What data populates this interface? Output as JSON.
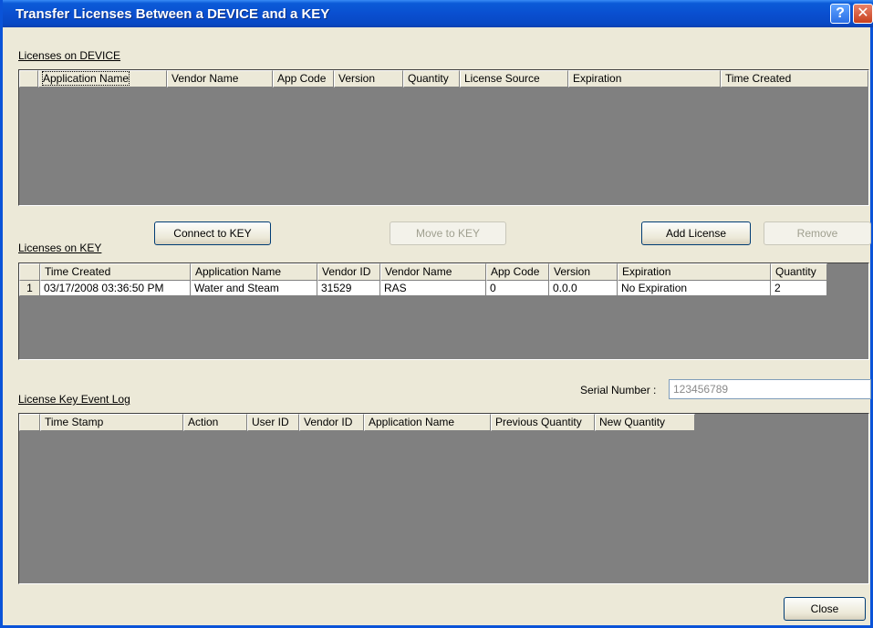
{
  "window": {
    "title": "Transfer Licenses Between a DEVICE and a KEY",
    "help": "?",
    "close": "✕"
  },
  "device": {
    "label": "Licenses on DEVICE",
    "columns": [
      "",
      "Application Name",
      "Vendor Name",
      "App Code",
      "Version",
      "Quantity",
      "License Source",
      "Expiration",
      "Time Created"
    ]
  },
  "buttons": {
    "connect": "Connect to KEY",
    "move": "Move to KEY",
    "add": "Add License",
    "remove": "Remove",
    "close": "Close"
  },
  "key": {
    "label": "Licenses on KEY",
    "columns": [
      "",
      "Time Created",
      "Application Name",
      "Vendor ID",
      "Vendor Name",
      "App Code",
      "Version",
      "Expiration",
      "Quantity"
    ],
    "rows": [
      [
        "1",
        "03/17/2008 03:36:50 PM",
        "Water and Steam",
        "31529",
        "RAS",
        "0",
        "0.0.0",
        "No Expiration",
        "2"
      ]
    ]
  },
  "log": {
    "label": "License Key Event Log",
    "columns": [
      "",
      "Time Stamp",
      "Action",
      "User ID",
      "Vendor ID",
      "Application Name",
      "Previous Quantity",
      "New Quantity"
    ]
  },
  "serial": {
    "label": "Serial Number :",
    "value": "123456789"
  }
}
